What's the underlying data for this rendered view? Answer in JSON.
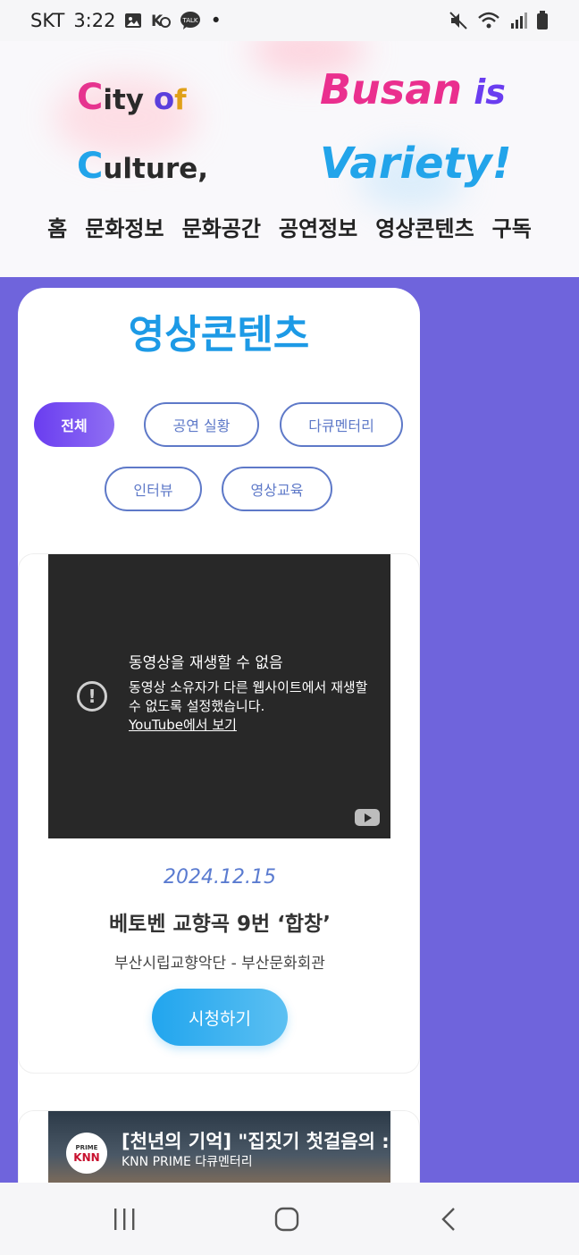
{
  "status_bar": {
    "carrier": "SKT",
    "time": "3:22",
    "notification_icons": [
      "image-icon",
      "k-icon",
      "talk-icon"
    ],
    "talk_label": "TALK",
    "dot": "•",
    "right_icons": [
      "mute-icon",
      "wifi-icon",
      "signal-icon",
      "battery-icon"
    ]
  },
  "header": {
    "logo_left": {
      "line1_c": "C",
      "line1_rest": "ity ",
      "line1_o": "o",
      "line1_f": "f",
      "line2_c": "C",
      "line2_rest": "ulture,"
    },
    "logo_right": {
      "line1_a": "Busan",
      "line1_b": " is",
      "line2": "Variety!"
    },
    "nav_items": [
      "홈",
      "문화정보",
      "문화공간",
      "공연정보",
      "영상콘텐츠",
      "구독"
    ]
  },
  "content": {
    "title": "영상콘텐츠",
    "filters": [
      "전체",
      "공연 실황",
      "다큐멘터리",
      "인터뷰",
      "영상교육"
    ],
    "active_filter": "전체",
    "videos": [
      {
        "player_error_title": "동영상을 재생할 수 없음",
        "player_error_body": "동영상 소유자가 다른 웹사이트에서 재생할 수 없도록 설정했습니다.",
        "player_link": "YouTube에서 보기",
        "date": "2024.12.15",
        "title": "베토벤 교향곡 9번 ‘합창’",
        "subtitle": "부산시립교향악단 - 부산문화회관",
        "button": "시청하기"
      },
      {
        "thumb_logo": "KNN",
        "thumb_logo_small": "PRIME",
        "thumb_title": "[천년의 기억] \"집짓기 첫걸음의 :",
        "thumb_subtitle": "KNN PRIME 다큐멘터리"
      }
    ]
  },
  "colors": {
    "accent": "#1d9ae6",
    "purple_bg": "#6f64dc",
    "chip": "#5e79c8",
    "active_chip": "#6a3df0"
  }
}
